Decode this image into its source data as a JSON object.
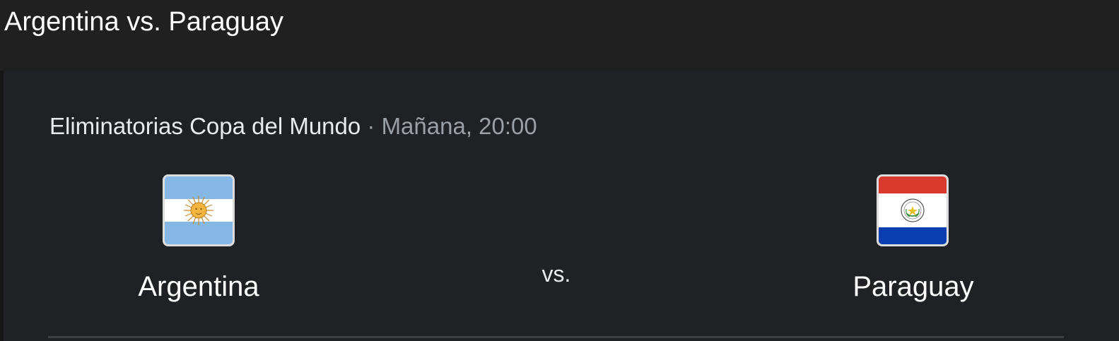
{
  "page": {
    "title": "Argentina vs. Paraguay"
  },
  "match": {
    "competition": "Eliminatorias Copa del Mundo",
    "separator": " · ",
    "time": "Mañana, 20:00",
    "vs_label": "vs.",
    "home_team": {
      "name": "Argentina",
      "flag_icon": "argentina-flag-icon",
      "colors": {
        "celeste": "#7fb6e3",
        "white": "#ffffff",
        "sun": "#f0b43c"
      }
    },
    "away_team": {
      "name": "Paraguay",
      "flag_icon": "paraguay-flag-icon",
      "colors": {
        "red": "#d62f28",
        "white": "#ffffff",
        "blue": "#0038a8"
      }
    }
  },
  "theme": {
    "background": "#202124",
    "header_background": "#202020",
    "text_primary": "#ffffff",
    "text_secondary": "#9aa0a6"
  }
}
